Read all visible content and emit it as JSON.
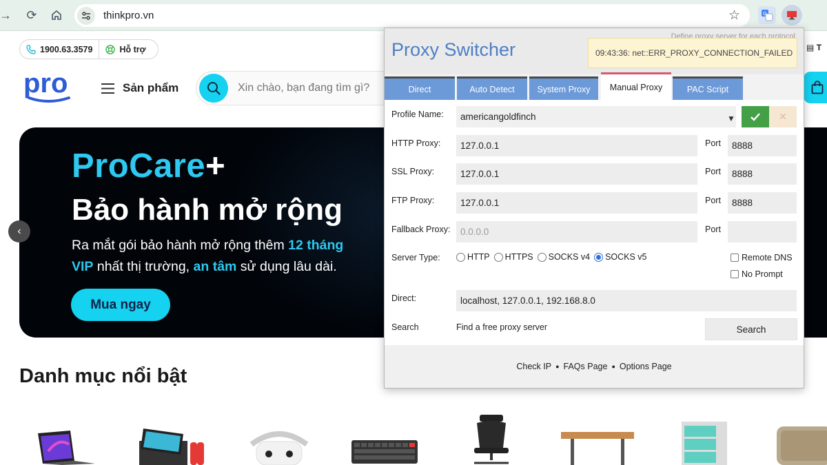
{
  "browser": {
    "url": "thinkpro.vn",
    "icons": [
      "back-arrow-icon",
      "reload-icon",
      "home-icon",
      "site-info-icon",
      "bookmark-star-icon",
      "translate-extension-icon",
      "proxy-switcher-extension-icon"
    ]
  },
  "page": {
    "hotline": "1900.63.3579",
    "support": "Hỗ trợ",
    "right_edge_text": "T",
    "logo_text": "pro",
    "menu_label": "Sản phẩm",
    "search_placeholder": "Xin chào, bạn đang tìm gì?",
    "banner": {
      "brand_pro": "ProCare",
      "brand_plus": "+",
      "title": "Bảo hành mở rộng",
      "line1_a": "Ra mắt gói bảo hành mở rộng thêm ",
      "line1_b": "12 tháng",
      "line2_a": "VIP",
      "line2_b": " nhất thị trường, ",
      "line2_c": "an tâm",
      "line2_d": " sử dụng lâu dài.",
      "cta": "Mua ngay"
    },
    "section_title": "Danh mục nổi bật",
    "colors": {
      "accent": "#14d2f0",
      "brand_blue": "#2e5bd6",
      "banner_bg": "#010409"
    }
  },
  "proxy_switcher": {
    "title": "Proxy Switcher",
    "hint": "Define proxy server for each protocol",
    "error": "09:43:36: net::ERR_PROXY_CONNECTION_FAILED",
    "tabs": [
      {
        "label": "Direct",
        "active": false
      },
      {
        "label": "Auto Detect",
        "active": false
      },
      {
        "label": "System Proxy",
        "active": false
      },
      {
        "label": "Manual Proxy",
        "active": true
      },
      {
        "label": "PAC Script",
        "active": false
      }
    ],
    "profile": {
      "label": "Profile Name:",
      "value": "americangoldfinch"
    },
    "http": {
      "label": "HTTP Proxy:",
      "host": "127.0.0.1",
      "port_label": "Port",
      "port": "8888"
    },
    "ssl": {
      "label": "SSL Proxy:",
      "host": "127.0.0.1",
      "port_label": "Port",
      "port": "8888"
    },
    "ftp": {
      "label": "FTP Proxy:",
      "host": "127.0.0.1",
      "port_label": "Port",
      "port": "8888"
    },
    "fallback": {
      "label": "Fallback Proxy:",
      "placeholder": "0.0.0.0",
      "port_label": "Port",
      "port": ""
    },
    "server_type": {
      "label": "Server Type:",
      "options": [
        "HTTP",
        "HTTPS",
        "SOCKS v4",
        "SOCKS v5"
      ],
      "selected": "SOCKS v5"
    },
    "remote_dns": {
      "label": "Remote DNS",
      "checked": false
    },
    "no_prompt": {
      "label": "No Prompt",
      "checked": false
    },
    "direct": {
      "label": "Direct:",
      "value": "localhost, 127.0.0.1, 192.168.8.0"
    },
    "search": {
      "label": "Search",
      "text": "Find a free proxy server",
      "button": "Search"
    },
    "footer": {
      "check_ip": "Check IP",
      "faqs": "FAQs Page",
      "options": "Options Page"
    }
  }
}
